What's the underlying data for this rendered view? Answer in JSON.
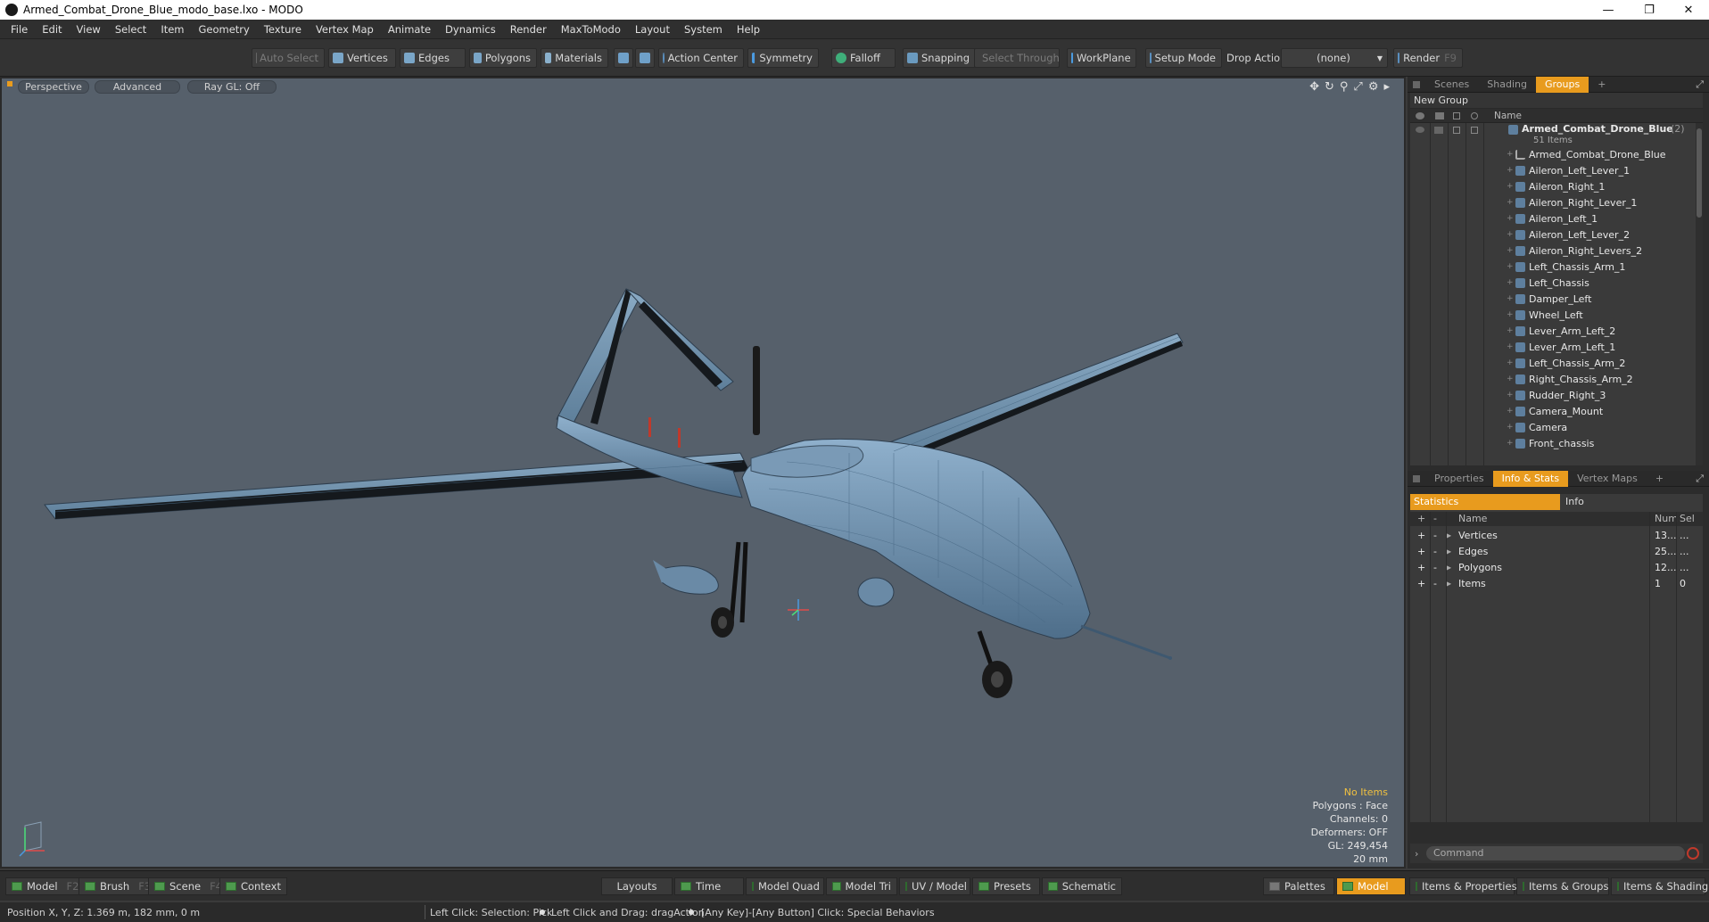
{
  "window": {
    "title": "Armed_Combat_Drone_Blue_modo_base.lxo - MODO"
  },
  "menu": [
    "File",
    "Edit",
    "View",
    "Select",
    "Item",
    "Geometry",
    "Texture",
    "Vertex Map",
    "Animate",
    "Dynamics",
    "Render",
    "MaxToModo",
    "Layout",
    "System",
    "Help"
  ],
  "toolbar": {
    "auto_select": "Auto Select",
    "vertices": "Vertices",
    "edges": "Edges",
    "polygons": "Polygons",
    "materials": "Materials",
    "action_center": "Action Center",
    "symmetry": "Symmetry",
    "falloff": "Falloff",
    "snapping": "Snapping",
    "select_through": "Select Through",
    "workplane": "WorkPlane",
    "setup_mode": "Setup Mode",
    "drop_action": "Drop Action",
    "drop_action_value": "(none)",
    "render": "Render",
    "render_key": "F9"
  },
  "viewport": {
    "tabs": [
      "Perspective",
      "Advanced",
      "Ray GL: Off"
    ],
    "info": {
      "no_items": "No Items",
      "polygons": "Polygons : Face",
      "channels": "Channels: 0",
      "deformers": "Deformers: OFF",
      "gl": "GL: 249,454",
      "scale": "20 mm"
    }
  },
  "scene_panel": {
    "tabs": [
      "Scenes",
      "Shading",
      "Groups"
    ],
    "add": "+",
    "new_group": "New Group",
    "name_col": "Name",
    "root": {
      "name": "Armed_Combat_Drone_Blue",
      "count": "(2)",
      "sub": "51 Items"
    },
    "items": [
      "Armed_Combat_Drone_Blue",
      "Aileron_Left_Lever_1",
      "Aileron_Right_1",
      "Aileron_Right_Lever_1",
      "Aileron_Left_1",
      "Aileron_Left_Lever_2",
      "Aileron_Right_Levers_2",
      "Left_Chassis_Arm_1",
      "Left_Chassis",
      "Damper_Left",
      "Wheel_Left",
      "Lever_Arm_Left_2",
      "Lever_Arm_Left_1",
      "Left_Chassis_Arm_2",
      "Right_Chassis_Arm_2",
      "Rudder_Right_3",
      "Camera_Mount",
      "Camera",
      "Front_chassis"
    ]
  },
  "props_panel": {
    "tabs": [
      "Properties",
      "Info & Stats",
      "Vertex Maps"
    ],
    "add": "+",
    "statistics": "Statistics",
    "info": "Info",
    "headers": {
      "plus": "+",
      "minus": "-",
      "name": "Name",
      "num": "Num",
      "sel": "Sel"
    },
    "rows": [
      {
        "name": "Vertices",
        "num": "13...",
        "sel": "..."
      },
      {
        "name": "Edges",
        "num": "25...",
        "sel": "..."
      },
      {
        "name": "Polygons",
        "num": "12...",
        "sel": "..."
      },
      {
        "name": "Items",
        "num": "1",
        "sel": "0"
      }
    ],
    "command_placeholder": "Command"
  },
  "bottombar": {
    "model": "Model",
    "model_key": "F2",
    "brush": "Brush",
    "brush_key": "F3",
    "scene": "Scene",
    "scene_key": "F4",
    "context": "Context",
    "layouts": "Layouts",
    "time": "Time",
    "model_quad": "Model Quad",
    "model_tri": "Model Tri",
    "uv_model": "UV / Model",
    "presets": "Presets",
    "schematic": "Schematic",
    "palettes": "Palettes",
    "model_active": "Model",
    "items_properties": "Items & Properties",
    "items_groups": "Items & Groups",
    "items_shading": "Items & Shading"
  },
  "status": {
    "position": "Position X, Y, Z:   1.369 m, 182 mm, 0 m",
    "hint1": "Left Click: Selection: Pick",
    "hint2": "Left Click and Drag: dragAction",
    "hint3": "[Any Key]-[Any Button] Click: Special Behaviors"
  }
}
